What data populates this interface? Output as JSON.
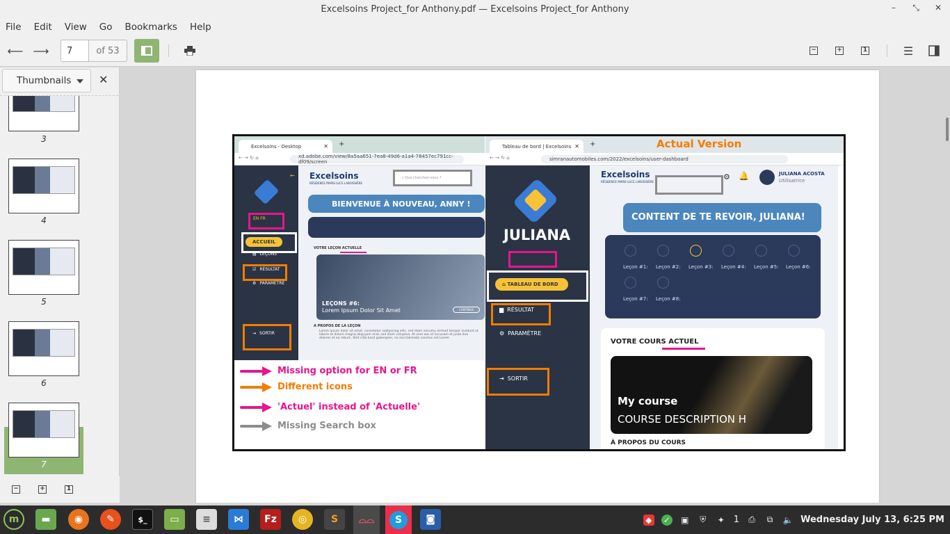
{
  "window": {
    "title": "Excelsoins Project_for Anthony.pdf — Excelsoins Project_for Anthony",
    "controls": [
      "minimize",
      "restore",
      "close"
    ]
  },
  "menu": [
    "File",
    "Edit",
    "View",
    "Go",
    "Bookmarks",
    "Help"
  ],
  "toolbar": {
    "page_value": "7",
    "page_of": "of 53"
  },
  "sidebar": {
    "mode_label": "Thumbnails",
    "thumbnails": [
      {
        "label": "3"
      },
      {
        "label": "4"
      },
      {
        "label": "5"
      },
      {
        "label": "6"
      },
      {
        "label": "7",
        "selected": true
      }
    ]
  },
  "document": {
    "left_app": {
      "tab_title": "Excelsoins - Desktop",
      "url": "xd.adobe.com/view/8a5aa651-7ea8-49d6-a1a4-78457ec791cc-df09/screen",
      "brand": "Excelsoins",
      "brand_tagline": "RÉSIDENCE MARIE-LUCE LABOISSIÈRE",
      "search_placeholder": "Que cherchez-vous ?",
      "lang": "EN  FR",
      "nav": [
        "ACCUEIL",
        "LEÇONS",
        "RÉSULTAT",
        "PARAMÈTRE",
        "SORTIR"
      ],
      "welcome": "BIENVENUE À NOUVEAU, ANNY !",
      "current_lesson_label": "VOTRE LEÇON ACTUELLE",
      "lesson_title": "LEÇONS #6:",
      "lesson_subtitle": "Lorem Ipsum Dolor Sit Amet",
      "continue_label": "CONTINUE",
      "about_label": "A PROPOS DE LA LEÇON",
      "about_text": "Lorem ipsum dolor sit amet, consetetur sadipscing elitr, sed diam nonumy eirmod tempor invidunt ut labore et dolore magna aliquyam erat, sed diam voluptua. At vero eos et accusam et justo duo dolores et ea rebum. Stet clita kasd gubergren, no sea takimata sanctus est Lorem"
    },
    "right_app": {
      "heading": "Actual Version",
      "tab_title": "Tableau de bord | Excelsoins",
      "url": "simranautomobiles.com/2022/excelsoins/user-dashboard",
      "brand": "Excelsoins",
      "brand_tagline": "RÉSIDENCE MARIE-LUCE LABOISSIÈRE",
      "app_name": "JULIANA",
      "user_name": "JULIANA ACOSTA",
      "user_role": "Utilisatrice",
      "nav": [
        "TABLEAU DE BORD",
        "RÉSULTAT",
        "PARAMÈTRE",
        "SORTIR"
      ],
      "welcome": "CONTENT DE TE REVOIR, JULIANA!",
      "lessons": [
        "Leçon #1:",
        "Leçon #2:",
        "Leçon #3:",
        "Leçon #4:",
        "Leçon #5:",
        "Leçon #6:",
        "Leçon #7:",
        "Leçon #8:"
      ],
      "course_label_prefix": "VOTRE COURS ",
      "course_label_hl": "ACTUEL",
      "course_title": "My course",
      "course_desc": "COURSE DESCRIPTION H",
      "about_label": "À PROPOS DU COURS"
    },
    "legend": [
      {
        "text": "Missing option for EN or FR",
        "color": "#e8158d",
        "arrow": "pink"
      },
      {
        "text": "Different icons",
        "color": "#f57c00",
        "arrow": "orange"
      },
      {
        "text": "'Actuel' instead of 'Actuelle'",
        "color": "#e8158d",
        "arrow": "pink"
      },
      {
        "text": "Missing Search box",
        "color": "#8c8c8c",
        "arrow": "gray"
      }
    ]
  },
  "taskbar": {
    "apps": [
      "menu",
      "files",
      "firefox",
      "inkscape",
      "terminal",
      "folder",
      "text-editor",
      "vscode",
      "filezilla",
      "chrome",
      "sublime",
      "document-viewer",
      "skype",
      "screenshot"
    ],
    "tray_count": "1",
    "clock": "Wednesday July 13,  6:25 PM"
  },
  "colors": {
    "accent_green": "#8fb573",
    "highlight_pink": "#e8158d",
    "highlight_orange": "#f57c00",
    "app_sidebar": "#2b3444",
    "app_yellow": "#f7c236"
  }
}
